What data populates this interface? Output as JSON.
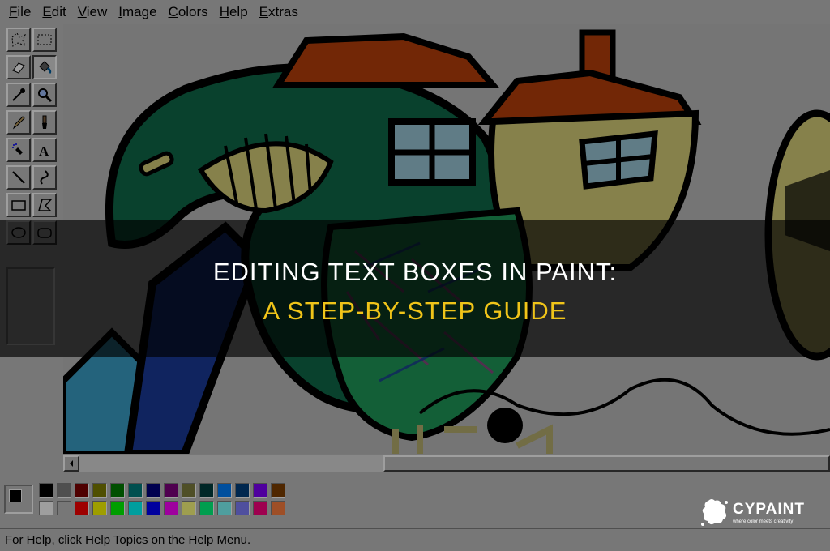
{
  "menu": [
    "File",
    "Edit",
    "View",
    "Image",
    "Colors",
    "Help",
    "Extras"
  ],
  "tools": [
    "free-select-icon",
    "rect-select-icon",
    "eraser-icon",
    "fill-icon",
    "color-picker-icon",
    "magnifier-icon",
    "pencil-icon",
    "brush-icon",
    "airbrush-icon",
    "text-icon",
    "line-icon",
    "curve-icon",
    "rectangle-icon",
    "polygon-icon",
    "ellipse-icon",
    "rounded-rect-icon"
  ],
  "palette": {
    "top": [
      "#000000",
      "#808080",
      "#800000",
      "#808000",
      "#008000",
      "#008080",
      "#000080",
      "#800080",
      "#808040",
      "#004040",
      "#0080ff",
      "#004080",
      "#8000ff",
      "#804000"
    ],
    "bottom": [
      "#ffffff",
      "#c0c0c0",
      "#ff0000",
      "#ffff00",
      "#00ff00",
      "#00ffff",
      "#0000ff",
      "#ff00ff",
      "#ffff80",
      "#00ff80",
      "#80ffff",
      "#8080ff",
      "#ff0080",
      "#ff8040"
    ]
  },
  "status": "For Help, click Help Topics on the Help Menu.",
  "banner": {
    "line1": "EDITING TEXT BOXES IN PAINT:",
    "line2": "A STEP-BY-STEP GUIDE"
  },
  "logo": {
    "name": "CYPAINT",
    "tagline": "where color meets creativity"
  }
}
